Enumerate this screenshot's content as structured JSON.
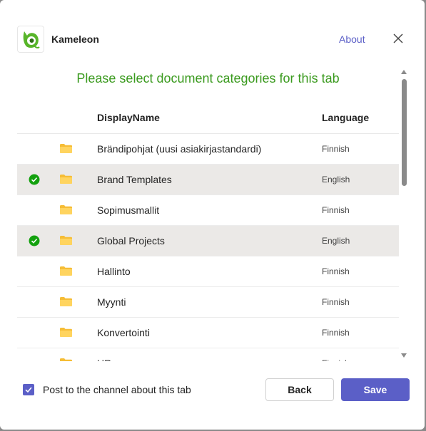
{
  "app": {
    "title": "Kameleon",
    "about_label": "About",
    "heading": "Please select document categories for this tab",
    "accent_color": "#5b5fc7",
    "heading_color": "#3a9a1e"
  },
  "table": {
    "columns": [
      "DisplayName",
      "Language"
    ],
    "rows": [
      {
        "name": "Brändipohjat (uusi asiakirjastandardi)",
        "language": "Finnish",
        "selected": false
      },
      {
        "name": "Brand Templates",
        "language": "English",
        "selected": true
      },
      {
        "name": "Sopimusmallit",
        "language": "Finnish",
        "selected": false
      },
      {
        "name": "Global Projects",
        "language": "English",
        "selected": true
      },
      {
        "name": "Hallinto",
        "language": "Finnish",
        "selected": false
      },
      {
        "name": "Myynti",
        "language": "Finnish",
        "selected": false
      },
      {
        "name": "Konvertointi",
        "language": "Finnish",
        "selected": false
      },
      {
        "name": "HR",
        "language": "Finnish",
        "selected": false
      }
    ]
  },
  "footer": {
    "checkbox_label": "Post to the channel about this tab",
    "checkbox_checked": true,
    "back_label": "Back",
    "save_label": "Save"
  },
  "icons": {
    "logo": "chameleon-logo-icon",
    "close": "close-icon",
    "folder": "folder-icon",
    "check": "check-circle-icon"
  }
}
